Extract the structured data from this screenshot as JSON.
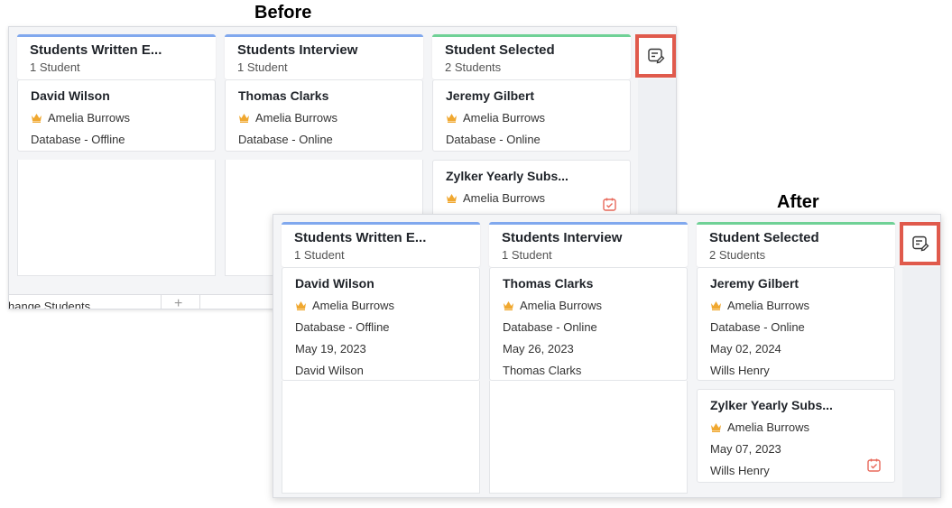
{
  "captions": {
    "before": "Before",
    "after": "After"
  },
  "before": {
    "columns": [
      {
        "title": "Students Written E...",
        "count": "1 Student",
        "cards": [
          {
            "name": "David Wilson",
            "owner": "Amelia Burrows",
            "mode": "Database - Offline"
          }
        ]
      },
      {
        "title": "Students Interview",
        "count": "1 Student",
        "cards": [
          {
            "name": "Thomas Clarks",
            "owner": "Amelia Burrows",
            "mode": "Database - Online"
          }
        ]
      },
      {
        "title": "Student Selected",
        "count": "2 Students",
        "cards": [
          {
            "name": "Jeremy Gilbert",
            "owner": "Amelia Burrows",
            "mode": "Database - Online"
          },
          {
            "name": "Zylker Yearly Subs...",
            "owner": "Amelia Burrows"
          }
        ]
      }
    ],
    "bottom_label": "hange Students",
    "add_symbol": "+"
  },
  "after": {
    "columns": [
      {
        "title": "Students Written E...",
        "count": "1 Student",
        "cards": [
          {
            "name": "David Wilson",
            "owner": "Amelia Burrows",
            "mode": "Database - Offline",
            "date": "May 19, 2023",
            "contact": "David Wilson"
          }
        ]
      },
      {
        "title": "Students Interview",
        "count": "1 Student",
        "cards": [
          {
            "name": "Thomas Clarks",
            "owner": "Amelia Burrows",
            "mode": "Database - Online",
            "date": "May 26, 2023",
            "contact": "Thomas Clarks"
          }
        ]
      },
      {
        "title": "Student Selected",
        "count": "2 Students",
        "cards": [
          {
            "name": "Jeremy Gilbert",
            "owner": "Amelia Burrows",
            "mode": "Database - Online",
            "date": "May 02, 2024",
            "contact": "Wills Henry"
          },
          {
            "name": "Zylker Yearly Subs...",
            "owner": "Amelia Burrows",
            "date": "May 07, 2023",
            "contact": "Wills Henry"
          }
        ]
      }
    ]
  },
  "colors": {
    "highlight": "#e05a4c",
    "column_blue": "#80a8ee",
    "column_green": "#6fd196",
    "crown": "#f0a830",
    "calendar": "#e8685a"
  },
  "icons": {
    "edit": "edit-note-icon",
    "owner": "crown-icon",
    "task": "calendar-check-icon"
  }
}
